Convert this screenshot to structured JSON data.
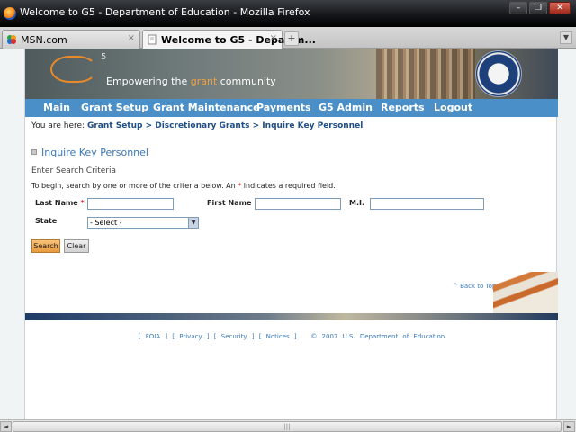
{
  "window": {
    "title": "Welcome to G5 - Department of Education - Mozilla Firefox",
    "minimize_glyph": "–",
    "maximize_glyph": "❐",
    "close_glyph": "✕"
  },
  "tabs": [
    {
      "label": "MSN.com",
      "close_glyph": "×",
      "active": false
    },
    {
      "label": "Welcome to G5 - Departm...",
      "close_glyph": "×",
      "active": true
    }
  ],
  "new_tab_glyph": "+",
  "list_tabs_glyph": "▼",
  "banner": {
    "logo_suffix": "5",
    "tagline_before": "Empowering the ",
    "tagline_highlight": "grant",
    "tagline_after": " community"
  },
  "nav": [
    {
      "label": "Main"
    },
    {
      "label": "Grant Setup"
    },
    {
      "label": "Grant Maintenance"
    },
    {
      "label": "Payments"
    },
    {
      "label": "G5 Admin"
    },
    {
      "label": "Reports"
    },
    {
      "label": "Logout"
    }
  ],
  "breadcrumb": {
    "prefix": "You are here: ",
    "link": "Grant Setup > Discretionary Grants > Inquire Key Personnel"
  },
  "page_title": "Inquire Key Personnel",
  "subheading": "Enter Search Criteria",
  "instructions": {
    "before": "To begin, search by one or more of the criteria below. An ",
    "marker": "*",
    "after": " indicates a required field."
  },
  "form": {
    "last_name_label": "Last Name",
    "required_marker": "*",
    "first_name_label": "First Name",
    "mi_label": "M.I.",
    "state_label": "State",
    "last_name_value": "",
    "first_name_value": "",
    "mi_value": "",
    "state_selected": "- Select -"
  },
  "buttons": {
    "search": "Search",
    "clear": "Clear"
  },
  "back_to_top": "^ Back to Top",
  "footer": {
    "foia": "[ FOIA ]",
    "privacy": "[ Privacy ]",
    "security": "[ Security ]",
    "notices": "[ Notices ]",
    "copyright": "© 2007 U.S. Department of Education"
  },
  "scrollbar": {
    "left_glyph": "◄",
    "right_glyph": "►",
    "grip": "|||"
  },
  "colors": {
    "nav_blue": "#4a8fc8",
    "link_blue": "#3a78b8",
    "required_red": "#d02020",
    "search_orange": "#e89a3e"
  }
}
